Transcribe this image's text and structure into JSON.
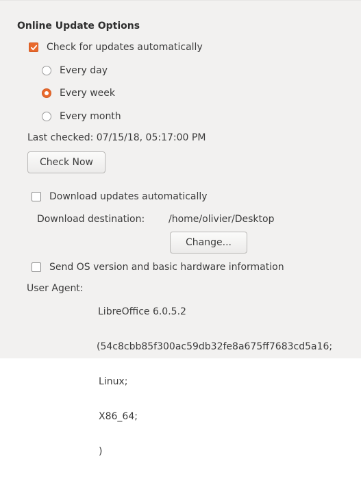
{
  "section_title": "Online Update Options",
  "auto_check": {
    "label": "Check for updates automatically",
    "checked": true
  },
  "frequency": {
    "options": [
      "Every day",
      "Every week",
      "Every month"
    ],
    "selected": "Every week"
  },
  "last_checked": "Last checked: 07/15/18, 05:17:00 PM",
  "check_now_button": "Check Now",
  "auto_download": {
    "label": "Download updates automatically",
    "checked": false
  },
  "download_destination": {
    "label": "Download destination:",
    "path": "/home/olivier/Desktop",
    "change_button": "Change..."
  },
  "send_os_info": {
    "label": "Send OS version and basic hardware information",
    "checked": false
  },
  "user_agent": {
    "label": "User Agent:",
    "lines": [
      "LibreOffice 6.0.5.2",
      "(54c8cbb85f300ac59db32fe8a675ff7683cd5a16;",
      "Linux;",
      "X86_64;",
      ")"
    ]
  },
  "accent_color": "#e9692c"
}
